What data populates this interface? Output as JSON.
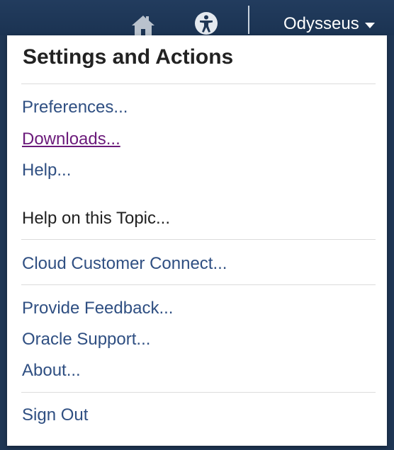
{
  "header": {
    "icons": [
      "home-icon",
      "accessibility-icon"
    ],
    "user_name": "Odysseus"
  },
  "panel": {
    "title": "Settings and Actions",
    "groups": [
      [
        "Preferences...",
        "Downloads...",
        "Help..."
      ],
      [
        "Help on this Topic..."
      ],
      [
        "Cloud Customer Connect..."
      ],
      [
        "Provide Feedback...",
        "Oracle Support...",
        "About..."
      ],
      [
        "Sign Out"
      ]
    ]
  },
  "colors": {
    "topbar": "#1f3654",
    "link": "#2f4f82",
    "visited_link": "#6b1a7a",
    "dark_text": "#222222"
  }
}
